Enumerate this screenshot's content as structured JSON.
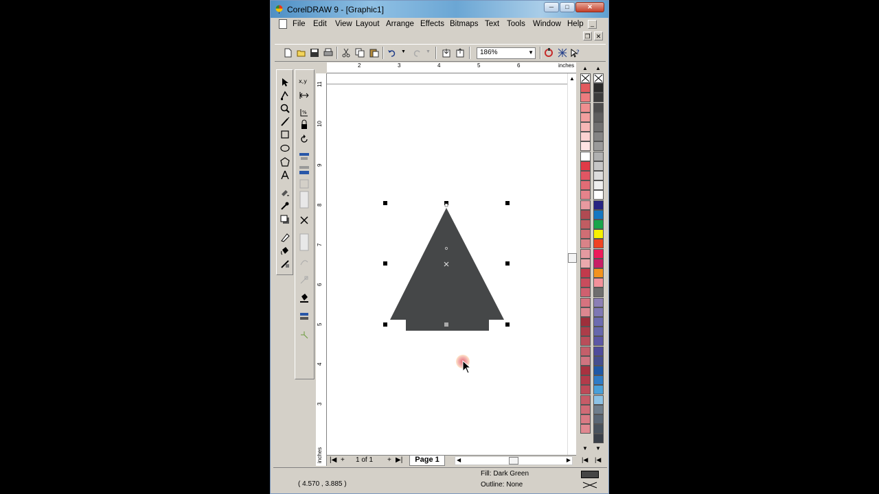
{
  "window": {
    "title": "CorelDRAW 9 - [Graphic1]"
  },
  "title_buttons": {
    "min": "─",
    "max": "□",
    "close": "✕"
  },
  "menu": {
    "items": [
      "File",
      "Edit",
      "View",
      "Layout",
      "Arrange",
      "Effects",
      "Bitmaps",
      "Text",
      "Tools",
      "Window",
      "Help"
    ],
    "mdi_min": "_",
    "mdi_restore": "❐",
    "mdi_close": "✕"
  },
  "toolbar": {
    "zoom": "186%",
    "icons": [
      "new-icon",
      "open-icon",
      "save-icon",
      "print-icon",
      "cut-icon",
      "copy-icon",
      "paste-icon",
      "undo-icon",
      "redo-icon",
      "import-icon",
      "export-icon",
      "application-launcher-icon",
      "corel-online-icon",
      "whats-this-icon"
    ]
  },
  "rulers": {
    "unit": "inches",
    "top_ticks": [
      "2",
      "3",
      "4",
      "5",
      "6"
    ],
    "left_ticks": [
      "11",
      "10",
      "9",
      "8",
      "7",
      "6",
      "5",
      "4",
      "3"
    ],
    "left_unit": "inches"
  },
  "page_nav": {
    "first": "|◀",
    "add_before": "+",
    "count": "1 of 1",
    "add_after": "+",
    "last": "▶|",
    "page_tab": "Page 1"
  },
  "status": {
    "coords": "( 4.570 , 3.885 )",
    "fill": "Fill: Dark Green",
    "outline": "Outline: None"
  },
  "palette_left": [
    "#ffffff",
    "#e25a5e",
    "#ec7c7f",
    "#ee8f90",
    "#f19f9f",
    "#f6b7b6",
    "#fbd2d1",
    "#ffe4e4",
    "#ffffff",
    "#e03a47",
    "#e05663",
    "#e26c75",
    "#e5838b",
    "#e89aa0",
    "#b04a52",
    "#c05d62",
    "#d06e74",
    "#d98388",
    "#e39aa0",
    "#eaa9ad",
    "#c23a4c",
    "#c84c5d",
    "#cf606f",
    "#d6737f",
    "#dd8790",
    "#9e2f3b",
    "#ac3d49",
    "#b94e5a",
    "#c45f6a",
    "#d07480",
    "#a83240",
    "#b23b4a",
    "#bd4a58",
    "#c65b67",
    "#d06b76",
    "#d97a84",
    "#e08890"
  ],
  "palette_right": [
    "#ffffff",
    "#2b2b2b",
    "#3c3c3c",
    "#4d4d4d",
    "#5e5e5e",
    "#707070",
    "#848484",
    "#9a9a9a",
    "#b0b0b0",
    "#c6c6c6",
    "#dcdcdc",
    "#eeeeee",
    "#ffffff",
    "#262482",
    "#1477c2",
    "#19a54a",
    "#f6f000",
    "#ef4423",
    "#ed1c5a",
    "#c71f66",
    "#f3931f",
    "#f2919a",
    "#6e6e6e",
    "#8b7fb5",
    "#7e78b4",
    "#6c6cb0",
    "#6668ac",
    "#5c58a5",
    "#4e4c9b",
    "#454f8f",
    "#1f59a6",
    "#2f7cc6",
    "#4aa0d9",
    "#8dc3e6",
    "#6f7e8c",
    "#5a6775",
    "#48525d",
    "#3a4049"
  ]
}
